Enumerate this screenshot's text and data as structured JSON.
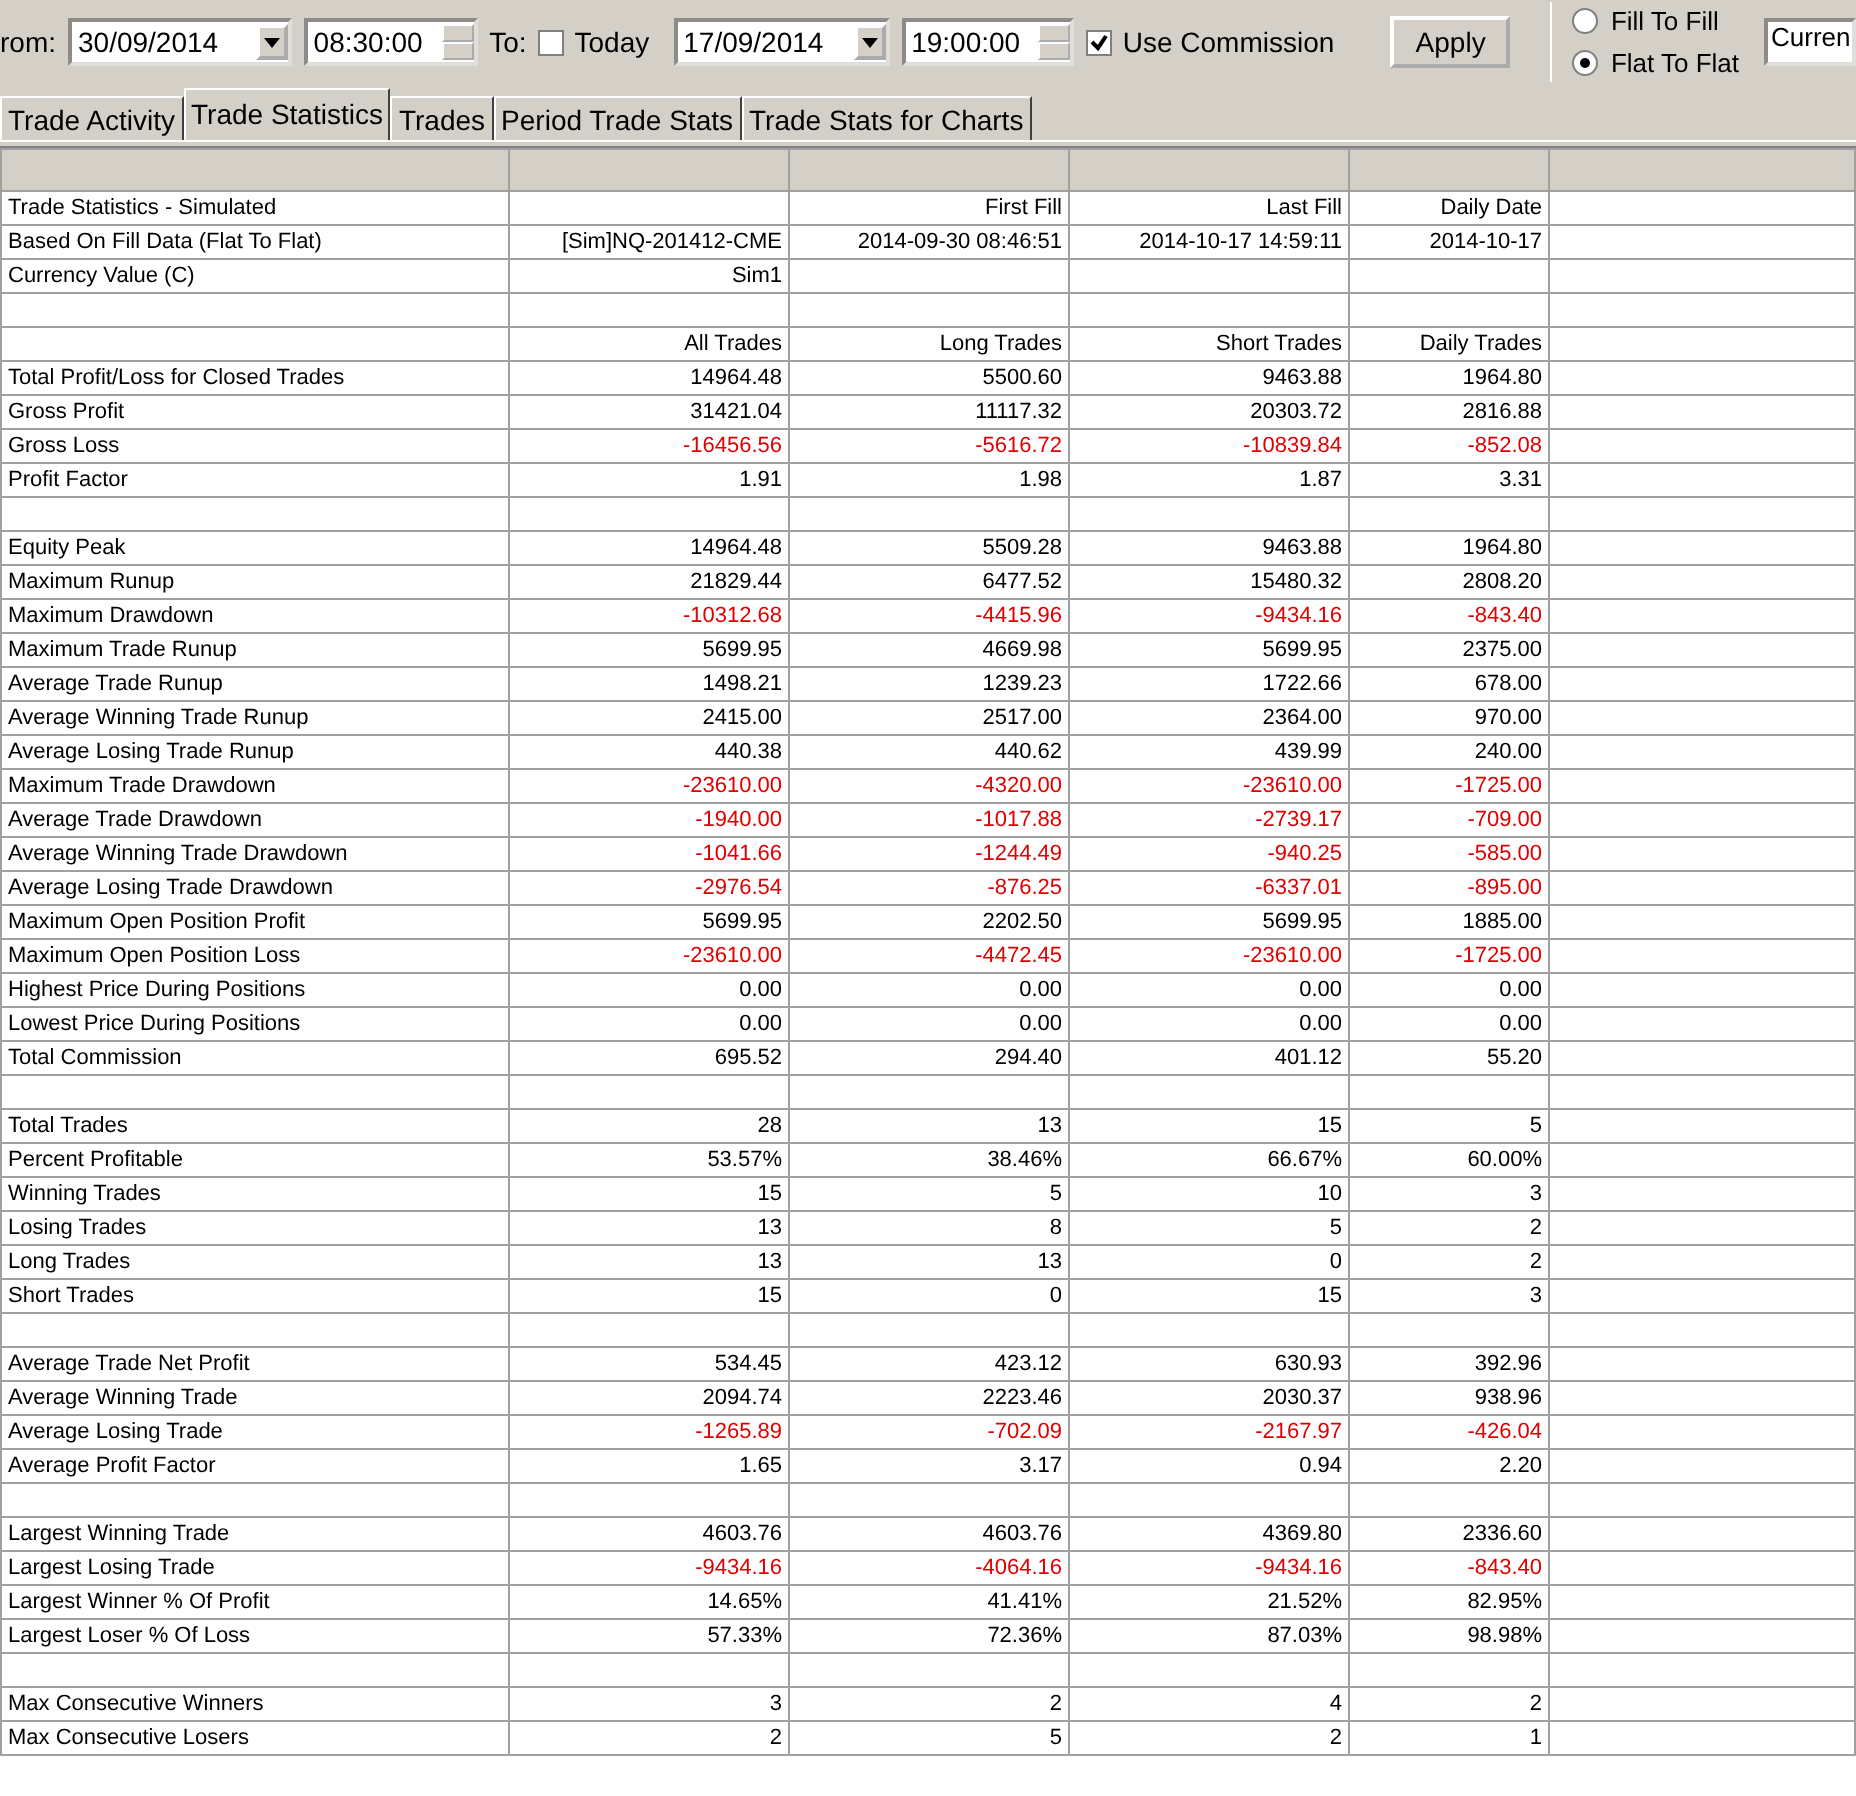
{
  "toolbar": {
    "from_label": "rom:",
    "from_date": "30/09/2014",
    "from_time": "08:30:00",
    "to_label": "To:",
    "today": {
      "label": "Today",
      "checked": false
    },
    "to_date": "17/09/2014",
    "to_time": "19:00:00",
    "commission": {
      "label": "Use Commission",
      "checked": true
    },
    "apply": "Apply",
    "modes": [
      {
        "label": "Fill To Fill",
        "selected": false
      },
      {
        "label": "Flat To Flat",
        "selected": true
      }
    ],
    "currency": "Curren"
  },
  "tabs": [
    {
      "label": "Trade Activity",
      "selected": false
    },
    {
      "label": "Trade Statistics",
      "selected": true
    },
    {
      "label": "Trades",
      "selected": false
    },
    {
      "label": "Period Trade Stats",
      "selected": false
    },
    {
      "label": "Trade Stats for Charts",
      "selected": false
    }
  ],
  "rows": [
    {
      "kind": "data",
      "cells": [
        "Trade Statistics - Simulated",
        null,
        "First Fill",
        "Last Fill",
        "Daily Date"
      ],
      "negative": false
    },
    {
      "kind": "data",
      "cells": [
        "Based On Fill Data (Flat To Flat)",
        "[Sim]NQ-201412-CME",
        "2014-09-30  08:46:51",
        "2014-10-17  14:59:11",
        "2014-10-17"
      ],
      "negative": false
    },
    {
      "kind": "data",
      "cells": [
        "Currency Value (C)",
        "Sim1",
        null,
        null,
        null
      ],
      "negative": false
    },
    {
      "kind": "spacer"
    },
    {
      "kind": "data",
      "cells": [
        null,
        "All Trades",
        "Long Trades",
        "Short Trades",
        "Daily Trades"
      ],
      "negative": false
    },
    {
      "kind": "data",
      "cells": [
        "Total Profit/Loss for Closed Trades",
        "14964.48",
        "5500.60",
        "9463.88",
        "1964.80"
      ],
      "negative": false
    },
    {
      "kind": "data",
      "cells": [
        "Gross Profit",
        "31421.04",
        "11117.32",
        "20303.72",
        "2816.88"
      ],
      "negative": false
    },
    {
      "kind": "data",
      "cells": [
        "Gross Loss",
        "-16456.56",
        "-5616.72",
        "-10839.84",
        "-852.08"
      ],
      "negative": true
    },
    {
      "kind": "data",
      "cells": [
        "Profit Factor",
        "1.91",
        "1.98",
        "1.87",
        "3.31"
      ],
      "negative": false
    },
    {
      "kind": "spacer"
    },
    {
      "kind": "data",
      "cells": [
        "Equity Peak",
        "14964.48",
        "5509.28",
        "9463.88",
        "1964.80"
      ],
      "negative": false
    },
    {
      "kind": "data",
      "cells": [
        "Maximum Runup",
        "21829.44",
        "6477.52",
        "15480.32",
        "2808.20"
      ],
      "negative": false
    },
    {
      "kind": "data",
      "cells": [
        "Maximum Drawdown",
        "-10312.68",
        "-4415.96",
        "-9434.16",
        "-843.40"
      ],
      "negative": true
    },
    {
      "kind": "data",
      "cells": [
        "Maximum Trade Runup",
        "5699.95",
        "4669.98",
        "5699.95",
        "2375.00"
      ],
      "negative": false
    },
    {
      "kind": "data",
      "cells": [
        "Average Trade Runup",
        "1498.21",
        "1239.23",
        "1722.66",
        "678.00"
      ],
      "negative": false
    },
    {
      "kind": "data",
      "cells": [
        "Average Winning Trade Runup",
        "2415.00",
        "2517.00",
        "2364.00",
        "970.00"
      ],
      "negative": false
    },
    {
      "kind": "data",
      "cells": [
        "Average Losing Trade Runup",
        "440.38",
        "440.62",
        "439.99",
        "240.00"
      ],
      "negative": false
    },
    {
      "kind": "data",
      "cells": [
        "Maximum Trade Drawdown",
        "-23610.00",
        "-4320.00",
        "-23610.00",
        "-1725.00"
      ],
      "negative": true
    },
    {
      "kind": "data",
      "cells": [
        "Average Trade Drawdown",
        "-1940.00",
        "-1017.88",
        "-2739.17",
        "-709.00"
      ],
      "negative": true
    },
    {
      "kind": "data",
      "cells": [
        "Average Winning Trade Drawdown",
        "-1041.66",
        "-1244.49",
        "-940.25",
        "-585.00"
      ],
      "negative": true
    },
    {
      "kind": "data",
      "cells": [
        "Average Losing Trade Drawdown",
        "-2976.54",
        "-876.25",
        "-6337.01",
        "-895.00"
      ],
      "negative": true
    },
    {
      "kind": "data",
      "cells": [
        "Maximum Open Position Profit",
        "5699.95",
        "2202.50",
        "5699.95",
        "1885.00"
      ],
      "negative": false
    },
    {
      "kind": "data",
      "cells": [
        "Maximum Open Position Loss",
        "-23610.00",
        "-4472.45",
        "-23610.00",
        "-1725.00"
      ],
      "negative": true
    },
    {
      "kind": "data",
      "cells": [
        "Highest Price During Positions",
        "0.00",
        "0.00",
        "0.00",
        "0.00"
      ],
      "negative": false
    },
    {
      "kind": "data",
      "cells": [
        "Lowest Price During Positions",
        "0.00",
        "0.00",
        "0.00",
        "0.00"
      ],
      "negative": false
    },
    {
      "kind": "data",
      "cells": [
        "Total Commission",
        "695.52",
        "294.40",
        "401.12",
        "55.20"
      ],
      "negative": false
    },
    {
      "kind": "spacer"
    },
    {
      "kind": "data",
      "cells": [
        "Total Trades",
        "28",
        "13",
        "15",
        "5"
      ],
      "negative": false
    },
    {
      "kind": "data",
      "cells": [
        "Percent Profitable",
        "53.57%",
        "38.46%",
        "66.67%",
        "60.00%"
      ],
      "negative": false
    },
    {
      "kind": "data",
      "cells": [
        "Winning Trades",
        "15",
        "5",
        "10",
        "3"
      ],
      "negative": false
    },
    {
      "kind": "data",
      "cells": [
        "Losing Trades",
        "13",
        "8",
        "5",
        "2"
      ],
      "negative": false
    },
    {
      "kind": "data",
      "cells": [
        "Long Trades",
        "13",
        "13",
        "0",
        "2"
      ],
      "negative": false
    },
    {
      "kind": "data",
      "cells": [
        "Short Trades",
        "15",
        "0",
        "15",
        "3"
      ],
      "negative": false
    },
    {
      "kind": "spacer"
    },
    {
      "kind": "data",
      "cells": [
        "Average Trade Net Profit",
        "534.45",
        "423.12",
        "630.93",
        "392.96"
      ],
      "negative": false
    },
    {
      "kind": "data",
      "cells": [
        "Average Winning Trade",
        "2094.74",
        "2223.46",
        "2030.37",
        "938.96"
      ],
      "negative": false
    },
    {
      "kind": "data",
      "cells": [
        "Average Losing Trade",
        "-1265.89",
        "-702.09",
        "-2167.97",
        "-426.04"
      ],
      "negative": true
    },
    {
      "kind": "data",
      "cells": [
        "Average Profit Factor",
        "1.65",
        "3.17",
        "0.94",
        "2.20"
      ],
      "negative": false
    },
    {
      "kind": "spacer"
    },
    {
      "kind": "data",
      "cells": [
        "Largest Winning Trade",
        "4603.76",
        "4603.76",
        "4369.80",
        "2336.60"
      ],
      "negative": false
    },
    {
      "kind": "data",
      "cells": [
        "Largest Losing Trade",
        "-9434.16",
        "-4064.16",
        "-9434.16",
        "-843.40"
      ],
      "negative": true
    },
    {
      "kind": "data",
      "cells": [
        "Largest Winner % Of Profit",
        "14.65%",
        "41.41%",
        "21.52%",
        "82.95%"
      ],
      "negative": false
    },
    {
      "kind": "data",
      "cells": [
        "Largest Loser % Of Loss",
        "57.33%",
        "72.36%",
        "87.03%",
        "98.98%"
      ],
      "negative": false
    },
    {
      "kind": "spacer"
    },
    {
      "kind": "data",
      "cells": [
        "Max Consecutive Winners",
        "3",
        "2",
        "4",
        "2"
      ],
      "negative": false
    },
    {
      "kind": "data",
      "cells": [
        "Max Consecutive Losers",
        "2",
        "5",
        "2",
        "1"
      ],
      "negative": false
    }
  ]
}
